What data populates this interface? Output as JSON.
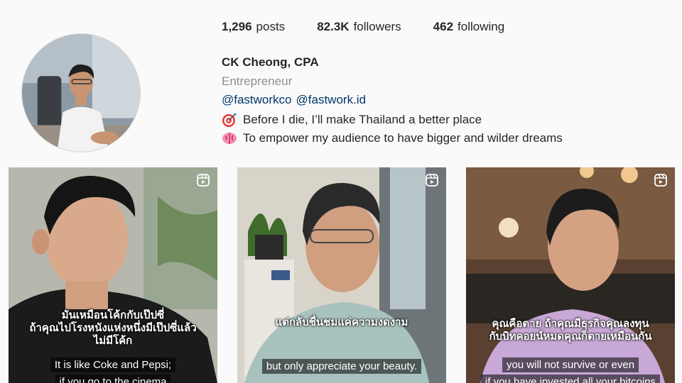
{
  "profile": {
    "stats": [
      {
        "count": "1,296",
        "label": "posts"
      },
      {
        "count": "82.3K",
        "label": "followers"
      },
      {
        "count": "462",
        "label": "following"
      }
    ],
    "name": "CK Cheong, CPA",
    "category": "Entrepreneur",
    "mentions": [
      "@fastworkco",
      "@fastwork.id"
    ],
    "bio": [
      {
        "icon": "target-emoji",
        "text": "Before I die, I’ll make Thailand a better place"
      },
      {
        "icon": "brain-emoji",
        "text": "To empower my audience to have bigger and wilder dreams"
      }
    ]
  },
  "posts": [
    {
      "type": "reel",
      "subtitle_th": "มันเหมือนโค้กกับเป๊ปซี่\nถ้าคุณไปโรงหนังแห่งหนึ่งมีเป๊ปซี่แล้ว\nไม่มีโค้ก",
      "subtitle_en_1": "It is like Coke and Pepsi;",
      "subtitle_en_2": "if you go to the cinema"
    },
    {
      "type": "reel",
      "subtitle_th": "แต่กลับชื่นชมแค่ความงดงาม",
      "subtitle_en_1": "but only appreciate your beauty.",
      "subtitle_en_2": ""
    },
    {
      "type": "reel",
      "subtitle_th": "คุณคือตาย ถ้าคุณมีธุรกิจคุณลงทุน\nกับบิทคอยน์หมดคุณก็ตายเหมือนกัน",
      "subtitle_en_1": "you will not survive or even",
      "subtitle_en_2": "if you have invested all your bitcoins"
    }
  ]
}
